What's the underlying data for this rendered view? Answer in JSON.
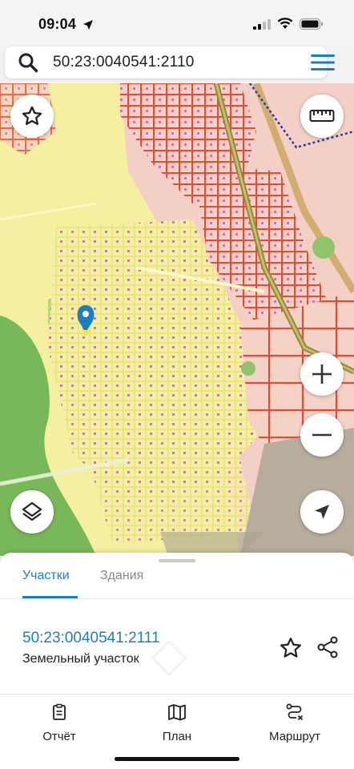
{
  "status": {
    "time": "09:04"
  },
  "search": {
    "query": "50:23:0040541:2110"
  },
  "map": {
    "controls": [
      "star-icon",
      "ruler-icon",
      "zoom-in-icon",
      "zoom-out-icon",
      "layers-icon",
      "navigation-arrow-icon"
    ],
    "colors": {
      "zone_yellow": "#f5efa0",
      "zone_pink": "#f3c9c0",
      "forest": "#79b85a",
      "parcel_border": "#e04a3a",
      "pin": "#1a7fbf"
    }
  },
  "sheet": {
    "tabs": [
      {
        "label": "Участки",
        "active": true
      },
      {
        "label": "Здания",
        "active": false
      }
    ],
    "result": {
      "id": "50:23:0040541:2111",
      "type": "Земельный участок"
    }
  },
  "nav": {
    "items": [
      {
        "label": "Отчёт",
        "icon": "report-icon"
      },
      {
        "label": "План",
        "icon": "map-plan-icon"
      },
      {
        "label": "Маршрут",
        "icon": "route-icon"
      }
    ]
  },
  "accent_color": "#1a7fbf"
}
